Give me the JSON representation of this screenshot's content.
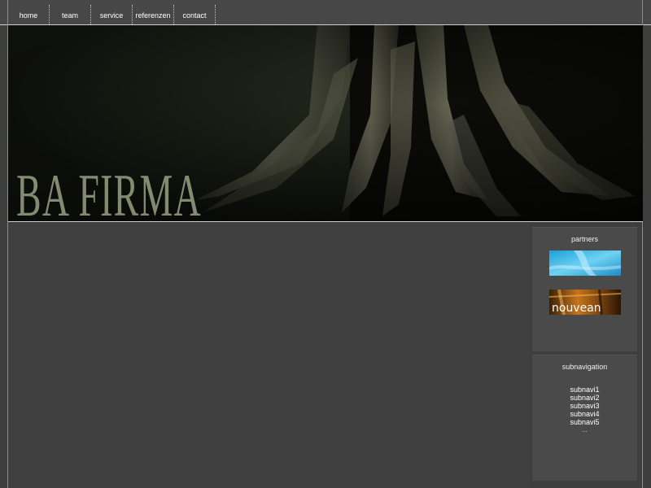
{
  "nav": {
    "items": [
      {
        "label": "home"
      },
      {
        "label": "team"
      },
      {
        "label": "service"
      },
      {
        "label": "referenzen"
      },
      {
        "label": "contact"
      }
    ]
  },
  "banner": {
    "brand_text": "BA FIRMA",
    "image_description_icon": "tree-roots-photo"
  },
  "partners": {
    "title": "partners",
    "logos": [
      {
        "name": "blue-partner-logo",
        "color": "#2aaee0"
      },
      {
        "name": "nouvean-partner-logo",
        "text": "nouvean",
        "color": "#d88a2a"
      }
    ]
  },
  "subnavigation": {
    "title": "subnavigation",
    "items": [
      "subnavi1",
      "subnavi2",
      "subnavi3",
      "subnavi4",
      "subnavi5"
    ],
    "more": "..."
  },
  "colors": {
    "background": "#3e3e3e",
    "topbar": "#474747",
    "sidebox": "#4a4a4a"
  }
}
